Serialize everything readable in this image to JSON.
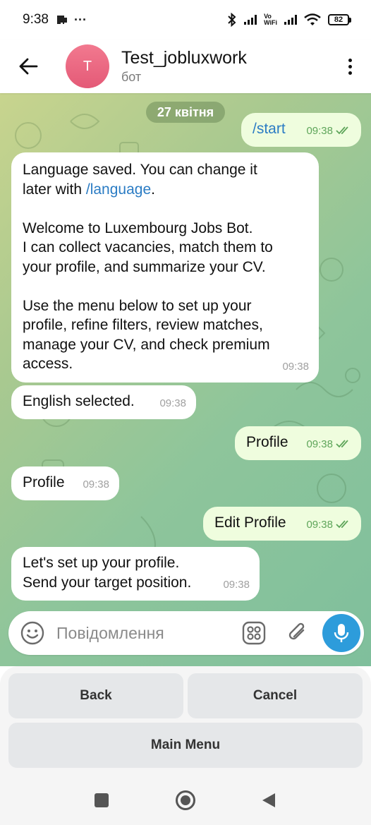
{
  "status_bar": {
    "time": "9:38",
    "dots": "···",
    "vowifi": [
      "Vo",
      "WiFi"
    ],
    "battery": "82"
  },
  "header": {
    "avatar_letter": "T",
    "title": "Test_jobluxwork",
    "subtitle": "бот"
  },
  "chat": {
    "date": "27 квітня",
    "messages": [
      {
        "direction": "out",
        "text": "/start",
        "time": "09:38"
      },
      {
        "direction": "in",
        "lines": [
          [
            "Language saved. You can change it"
          ],
          [
            "later with ",
            "/language",
            "."
          ],
          [
            ""
          ],
          [
            "Welcome to Luxembourg Jobs Bot."
          ],
          [
            "I can collect vacancies, match them to"
          ],
          [
            "your profile, and summarize your CV."
          ],
          [
            ""
          ],
          [
            "Use the menu below to set up your"
          ],
          [
            "profile, refine filters, review matches,"
          ],
          [
            "manage your CV, and check premium"
          ],
          [
            "access."
          ]
        ],
        "time": "09:38"
      },
      {
        "direction": "in",
        "text": "English selected.",
        "time": "09:38"
      },
      {
        "direction": "out",
        "text": "Profile",
        "time": "09:38"
      },
      {
        "direction": "in",
        "text": "Profile",
        "time": "09:38"
      },
      {
        "direction": "out",
        "text": "Edit Profile",
        "time": "09:38"
      },
      {
        "direction": "in",
        "lines": [
          [
            "Let's set up your profile."
          ],
          [
            "Send your target position."
          ]
        ],
        "time": "09:38"
      }
    ]
  },
  "composer": {
    "placeholder": "Повідомлення",
    "value": ""
  },
  "keyboard": {
    "buttons": [
      "Back",
      "Cancel",
      "Main Menu"
    ]
  },
  "colors": {
    "link": "#2b7cc4",
    "outgoing_bubble": "#effdde",
    "mic_button": "#2d9cdb",
    "read_checks": "#5ea55a"
  },
  "icons": [
    "back-arrow-icon",
    "more-vert-icon",
    "emoji-icon",
    "sticker-icon",
    "attach-icon",
    "mic-icon",
    "double-check-icon",
    "nav-square-icon",
    "nav-home-icon",
    "nav-back-icon"
  ]
}
